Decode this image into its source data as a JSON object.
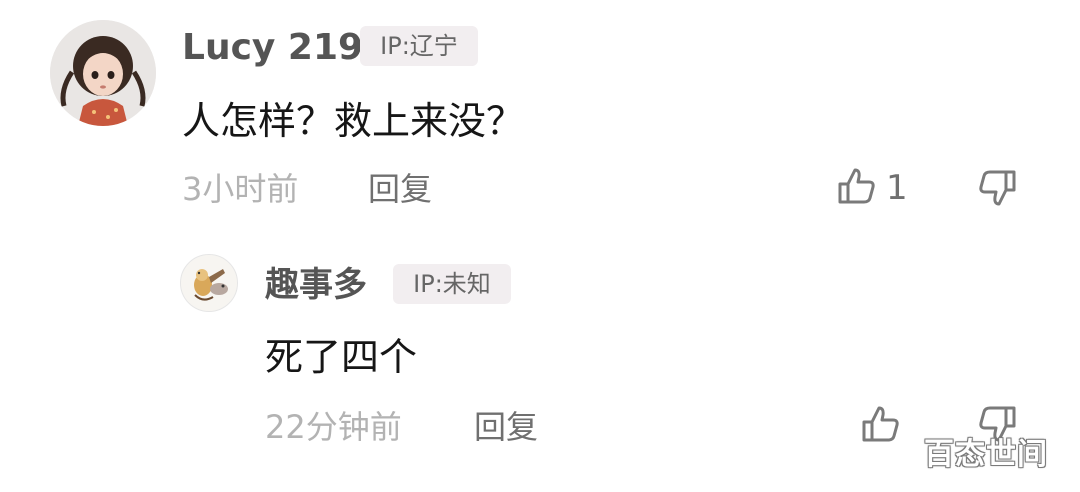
{
  "comment": {
    "username": "Lucy 219",
    "ip": "IP:辽宁",
    "text": "人怎样？救上来没？",
    "time": "3小时前",
    "reply_label": "回复",
    "like_count": "1"
  },
  "reply": {
    "username": "趣事多",
    "ip": "IP:未知",
    "text": "死了四个",
    "time": "22分钟前",
    "reply_label": "回复"
  },
  "watermark": "百态世间",
  "icons": {
    "like": "thumbs-up-icon",
    "dislike": "thumbs-down-icon"
  },
  "colors": {
    "username": "#555555",
    "ip_badge_bg": "#f2eef0",
    "meta": "#b3b3b3",
    "text": "#161616"
  }
}
